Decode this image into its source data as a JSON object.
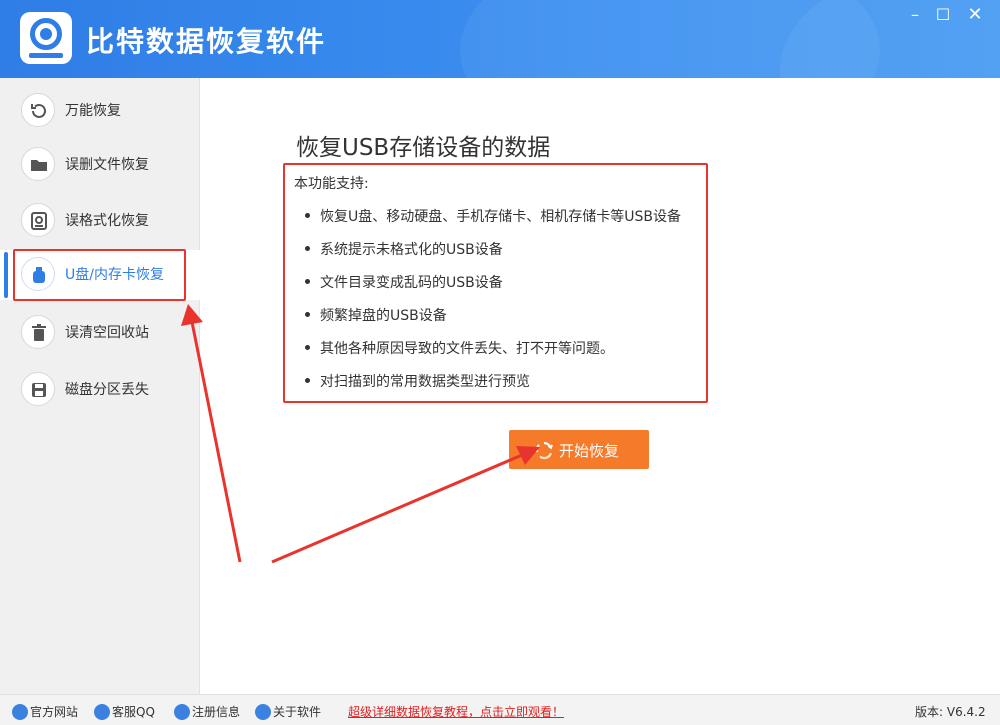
{
  "app": {
    "title": "比特数据恢复软件"
  },
  "window_controls": {
    "minimize": "–",
    "maximize": "☐",
    "close": "✕"
  },
  "sidebar": {
    "items": [
      {
        "label": "万能恢复",
        "icon": "undo-icon"
      },
      {
        "label": "误删文件恢复",
        "icon": "folder-icon"
      },
      {
        "label": "误格式化恢复",
        "icon": "disk-restore-icon"
      },
      {
        "label": "U盘/内存卡恢复",
        "icon": "usb-drive-icon",
        "active": true
      },
      {
        "label": "误清空回收站",
        "icon": "trash-icon"
      },
      {
        "label": "磁盘分区丢失",
        "icon": "save-disk-icon"
      }
    ]
  },
  "main": {
    "title": "恢复USB存储设备的数据",
    "support_label": "本功能支持:",
    "features": [
      "恢复U盘、移动硬盘、手机存储卡、相机存储卡等USB设备",
      "系统提示未格式化的USB设备",
      "文件目录变成乱码的USB设备",
      "频繁掉盘的USB设备",
      "其他各种原因导致的文件丢失、打不开等问题。",
      "对扫描到的常用数据类型进行预览"
    ],
    "start_button": "开始恢复"
  },
  "statusbar": {
    "website": "官方网站",
    "support_qq": "客服QQ",
    "register": "注册信息",
    "about": "关于软件",
    "tutorial_link": "超级详细数据恢复教程，点击立即观看！",
    "version": "版本: V6.4.2"
  },
  "colors": {
    "brand": "#2f7de6",
    "accent_orange": "#f57b2b",
    "annotation_red": "#e8342c"
  }
}
